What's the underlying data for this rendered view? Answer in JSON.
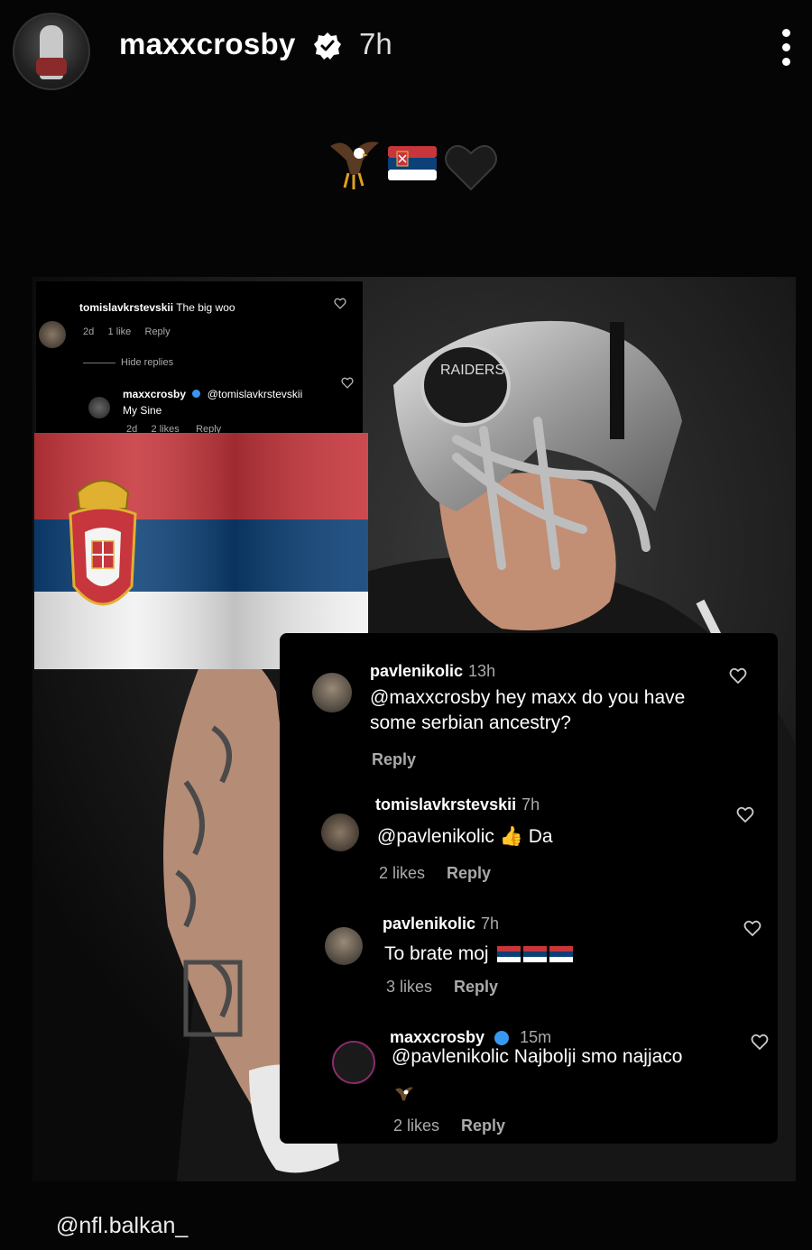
{
  "header": {
    "username": "maxxcrosby",
    "time": "7h"
  },
  "caption_emojis": [
    "eagle-icon",
    "serbia-flag-icon",
    "black-heart-icon"
  ],
  "top_comments": {
    "comment1": {
      "user": "tomislavkrstevskii",
      "text": "The big woo",
      "age": "2d",
      "likes": "1 like",
      "reply": "Reply"
    },
    "hide_replies": "Hide replies",
    "reply1": {
      "user": "maxxcrosby",
      "mention": "@tomislavkrstevskii",
      "text": "My Sine",
      "age": "2d",
      "likes": "2 likes",
      "reply": "Reply"
    }
  },
  "main_comments": [
    {
      "user": "pavlenikolic",
      "time": "13h",
      "text": "@maxxcrosby hey maxx do you have some serbian ancestry?",
      "reply": "Reply"
    },
    {
      "user": "tomislavkrstevskii",
      "time": "7h",
      "text": "@pavlenikolic 👍 Da",
      "likes": "2 likes",
      "reply": "Reply"
    },
    {
      "user": "pavlenikolic",
      "time": "7h",
      "text": "To brate moj",
      "likes": "3 likes",
      "reply": "Reply"
    },
    {
      "user": "maxxcrosby",
      "time": "15m",
      "text": "@pavlenikolic Najbolji smo najjaco",
      "likes": "2 likes",
      "reply": "Reply"
    }
  ],
  "watermark": "@nfl.balkan_",
  "colors": {
    "background": "#050505",
    "verified": "#3897f0",
    "serbia_red": "#c6363c",
    "serbia_blue": "#0c4076",
    "serbia_white": "#ffffff"
  }
}
